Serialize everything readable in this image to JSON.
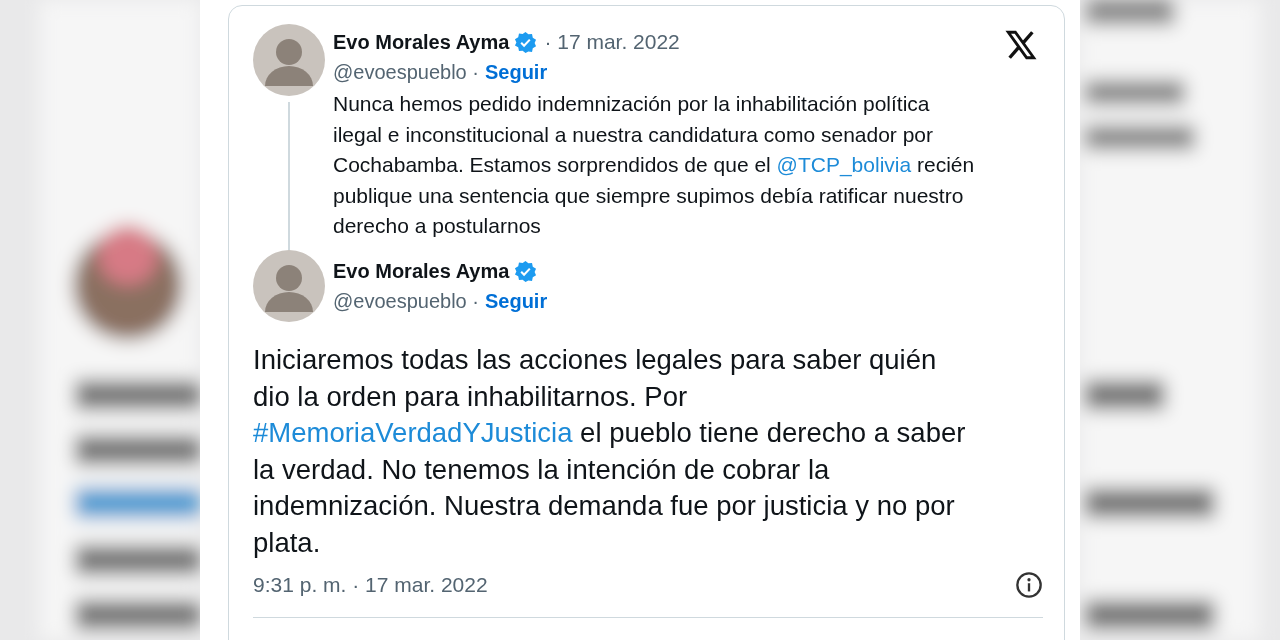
{
  "tweets": [
    {
      "kind": "quoted",
      "name": "Evo Morales Ayma",
      "verified": true,
      "date": "· 17 mar. 2022",
      "handle": "@evoespueblo ·",
      "follow": "Seguir",
      "body": [
        {
          "kind": "text",
          "text": "Nunca hemos pedido indemnización por la inhabilitación política\nilegal e inconstitucional a nuestra candidatura como senador por\nCochabamba. Estamos sorprendidos de que el "
        },
        {
          "kind": "link",
          "text": "@TCP_bolivia"
        },
        {
          "kind": "text",
          "text": " recién\npublique una sentencia que siempre supimos debía ratificar nuestro\nderecho a postularnos"
        }
      ]
    },
    {
      "kind": "main",
      "name": "Evo Morales Ayma",
      "verified": true,
      "handle": "@evoespueblo ·",
      "follow": "Seguir",
      "body": [
        {
          "kind": "text",
          "text": "Iniciaremos todas las acciones legales para saber quién\ndio la orden para inhabilitarnos. Por\n"
        },
        {
          "kind": "link",
          "text": "#MemoriaVerdadYJusticia"
        },
        {
          "kind": "text",
          "text": " el pueblo tiene derecho a saber\nla verdad. No tenemos la intención de cobrar la\nindemnización. Nuestra demanda fue por justicia y no por\nplata."
        }
      ],
      "timestamp": "9:31 p. m. · 17 mar. 2022"
    }
  ]
}
